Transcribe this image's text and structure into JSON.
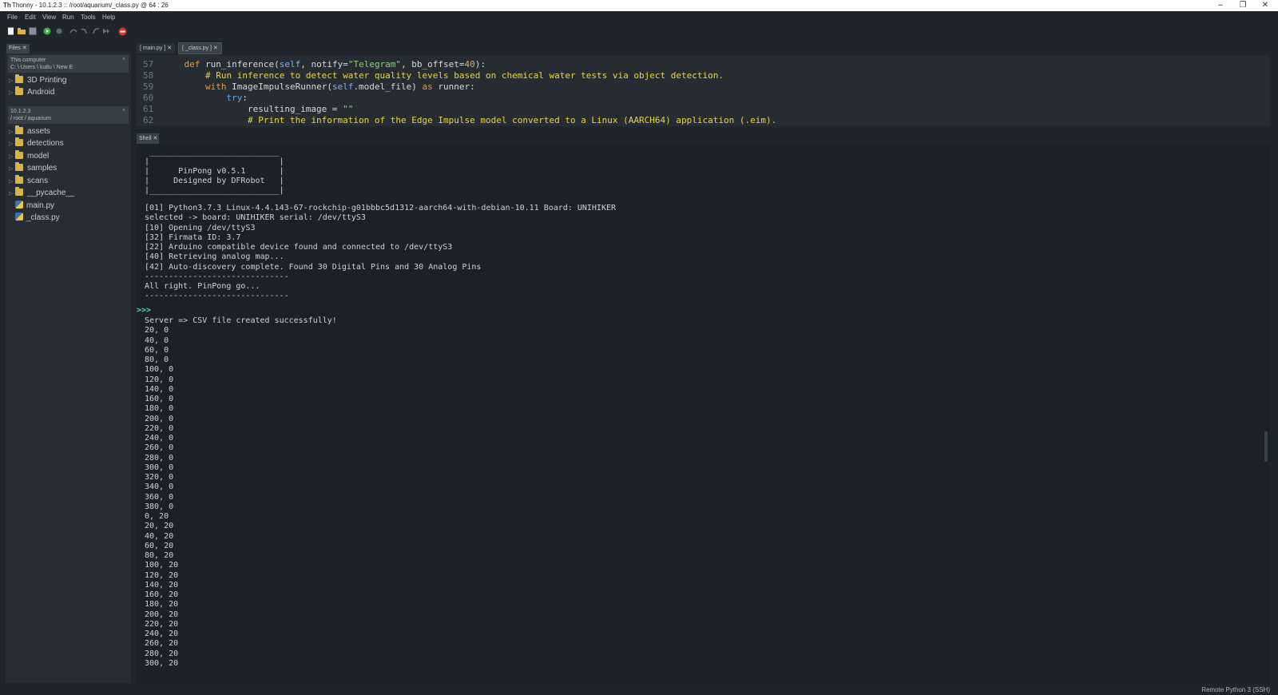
{
  "window": {
    "title": "Thonny  -  10.1.2.3 :: /root/aquarium/_class.py  @  64 : 26",
    "minimize": "–",
    "restore": "❐",
    "close": "✕"
  },
  "menu": [
    "File",
    "Edit",
    "View",
    "Run",
    "Tools",
    "Help"
  ],
  "toolbar_icons": [
    "new-file-icon",
    "open-file-icon",
    "save-icon",
    "run-icon",
    "debug-icon",
    "step-over-icon",
    "step-into-icon",
    "step-out-icon",
    "resume-icon",
    "stop-icon"
  ],
  "files": {
    "tab_label": "Files ✕",
    "this_computer": {
      "title": "This computer",
      "path": "C: \\ Users \\ kutlu \\ New E",
      "close": "×",
      "items": [
        "3D Printing",
        "Android"
      ]
    },
    "remote": {
      "title": "10.1.2.3",
      "path": "/ root / aquarium",
      "close": "×",
      "folders": [
        "assets",
        "detections",
        "model",
        "samples",
        "scans",
        "__pycache__"
      ],
      "files": [
        "main.py",
        "_class.py"
      ]
    }
  },
  "editor": {
    "tabs": [
      {
        "label": "[ main.py ]",
        "close": "✕"
      },
      {
        "label": "[ _class.py ]",
        "close": "✕"
      }
    ],
    "line_numbers": [
      "57",
      "58",
      "59",
      "60",
      "61",
      "62"
    ]
  },
  "shell": {
    "tab_label": "Shell ✕",
    "banner": [
      " ___________________________",
      "|                           |",
      "|      PinPong v0.5.1       |",
      "|     Designed by DFRobot   |",
      "|___________________________|"
    ],
    "log": [
      "[01] Python3.7.3 Linux-4.4.143-67-rockchip-g01bbbc5d1312-aarch64-with-debian-10.11 Board: UNIHIKER",
      "selected -> board: UNIHIKER serial: /dev/ttyS3",
      "[10] Opening /dev/ttyS3",
      "[32] Firmata ID: 3.7",
      "[22] Arduino compatible device found and connected to /dev/ttyS3",
      "[40] Retrieving analog map...",
      "[42] Auto-discovery complete. Found 30 Digital Pins and 30 Analog Pins",
      "------------------------------",
      "All right. PinPong go...",
      "------------------------------"
    ],
    "prompt": ">>>",
    "output": [
      "Server => CSV file created successfully!",
      "20, 0",
      "40, 0",
      "60, 0",
      "80, 0",
      "100, 0",
      "120, 0",
      "140, 0",
      "160, 0",
      "180, 0",
      "200, 0",
      "220, 0",
      "240, 0",
      "260, 0",
      "280, 0",
      "300, 0",
      "320, 0",
      "340, 0",
      "360, 0",
      "380, 0",
      "0, 20",
      "20, 20",
      "40, 20",
      "60, 20",
      "80, 20",
      "100, 20",
      "120, 20",
      "140, 20",
      "160, 20",
      "180, 20",
      "200, 20",
      "220, 20",
      "240, 20",
      "260, 20",
      "280, 20",
      "300, 20"
    ]
  },
  "status": "Remote Python 3 (SSH)"
}
